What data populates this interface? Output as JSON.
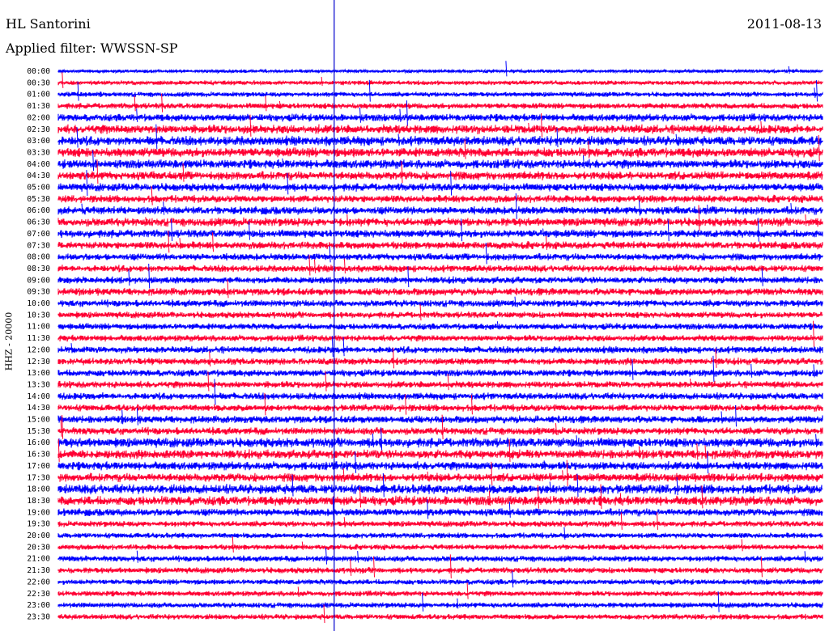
{
  "header": {
    "station": "HL Santorini",
    "date": "2011-08-13",
    "filter_prefix": "Applied filter:",
    "filter_name": "WWSSN-SP"
  },
  "channel_label": "HHZ - 20000",
  "colors": {
    "odd_trace": "#0000ff",
    "even_trace": "#ff0033",
    "marker": "#0000cc",
    "background": "#ffffff"
  },
  "chart_data": {
    "type": "line",
    "title": "HL Santorini",
    "subtitle": "Applied filter: WWSSN-SP",
    "ylabel": "HHZ - 20000",
    "row_labels": [
      "00:00",
      "00:30",
      "01:00",
      "01:30",
      "02:00",
      "02:30",
      "03:00",
      "03:30",
      "04:00",
      "04:30",
      "05:00",
      "05:30",
      "06:00",
      "06:30",
      "07:00",
      "07:30",
      "08:00",
      "08:30",
      "09:00",
      "09:30",
      "10:00",
      "10:30",
      "11:00",
      "11:30",
      "12:00",
      "12:30",
      "13:00",
      "13:30",
      "14:00",
      "14:30",
      "15:00",
      "15:30",
      "16:00",
      "16:30",
      "17:00",
      "17:30",
      "18:00",
      "18:30",
      "19:00",
      "19:30",
      "20:00",
      "20:30",
      "21:00",
      "21:30",
      "22:00",
      "22:30",
      "23:00",
      "23:30"
    ],
    "trace_minutes": 30,
    "series_colors": [
      "#0000ff",
      "#ff0033"
    ],
    "noise_level": [
      0.35,
      0.45,
      0.5,
      0.6,
      0.75,
      0.9,
      0.95,
      0.95,
      0.9,
      0.85,
      0.8,
      0.75,
      0.8,
      0.85,
      0.8,
      0.75,
      0.7,
      0.7,
      0.7,
      0.75,
      0.7,
      0.65,
      0.65,
      0.65,
      0.7,
      0.7,
      0.7,
      0.7,
      0.7,
      0.7,
      0.75,
      0.75,
      0.95,
      0.9,
      0.85,
      0.85,
      0.95,
      0.95,
      0.75,
      0.6,
      0.55,
      0.55,
      0.6,
      0.6,
      0.55,
      0.55,
      0.55,
      0.55
    ],
    "vertical_marker_fraction": 0.361
  }
}
